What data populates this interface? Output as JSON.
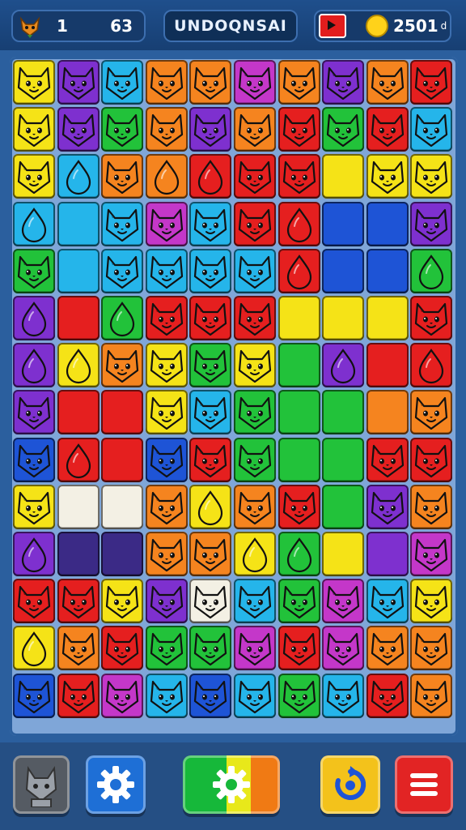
{
  "hud": {
    "level": "1",
    "moves": "63",
    "title": "UNDOQNSAI",
    "score": "2501",
    "score_unit": "d",
    "icons": {
      "level": "fox-mascot-icon",
      "flag": "red-flag-icon",
      "coin": "gold-coin-icon"
    }
  },
  "colors": {
    "R": "#e51f1f",
    "O": "#f5841f",
    "Y": "#f5e317",
    "G": "#22c23a",
    "C": "#25b5ea",
    "B": "#1e54d6",
    "P": "#7e30cf",
    "M": "#c437c9",
    "W": "#f3f0e4",
    "K": "#3b2a86"
  },
  "board": {
    "columns": 10,
    "rows": 14,
    "tiles": [
      [
        "Y:cat",
        "P:cat",
        "C:cat",
        "O:cat",
        "O:cat",
        "M:cat",
        "O:cat",
        "P:cat",
        "O:cat",
        "R:cat"
      ],
      [
        "Y:cat",
        "P:cat",
        "G:cat",
        "O:cat",
        "P:cat",
        "O:cat",
        "R:cat",
        "G:cat",
        "R:cat",
        "C:cat"
      ],
      [
        "Y:cat",
        "C:drop",
        "O:cat",
        "O:drop",
        "R:drop",
        "R:cat",
        "R:cat",
        "Y:",
        "Y:cat",
        "Y:cat"
      ],
      [
        "C:drop",
        "C:",
        "C:cat",
        "M:cat",
        "C:cat",
        "R:cat",
        "R:drop",
        "B:",
        "B:",
        "P:cat"
      ],
      [
        "G:cat",
        "C:",
        "C:cat",
        "C:cat",
        "C:cat",
        "C:cat",
        "R:drop",
        "B:",
        "B:",
        "G:drop"
      ],
      [
        "P:drop",
        "R:",
        "G:drop",
        "R:cat",
        "R:cat",
        "R:cat",
        "Y:",
        "Y:",
        "Y:",
        "R:cat"
      ],
      [
        "P:drop",
        "Y:drop",
        "O:cat",
        "Y:cat",
        "G:cat",
        "Y:cat",
        "G:",
        "P:drop",
        "R:",
        "R:drop"
      ],
      [
        "P:cat",
        "R:",
        "R:",
        "Y:cat",
        "C:cat",
        "G:cat",
        "G:",
        "G:",
        "O:",
        "O:cat"
      ],
      [
        "B:cat",
        "R:drop",
        "R:",
        "B:cat",
        "R:cat",
        "G:cat",
        "G:",
        "G:",
        "R:cat",
        "R:cat"
      ],
      [
        "Y:cat",
        "W:",
        "W:",
        "O:cat",
        "Y:drop",
        "O:cat",
        "R:cat",
        "G:",
        "P:cat",
        "O:cat"
      ],
      [
        "P:drop",
        "K:",
        "K:",
        "O:cat",
        "O:cat",
        "Y:drop",
        "G:drop",
        "Y:",
        "P:",
        "M:cat"
      ],
      [
        "R:cat",
        "R:cat",
        "Y:cat",
        "P:cat",
        "W:cat",
        "C:cat",
        "G:cat",
        "M:cat",
        "C:cat",
        "Y:cat"
      ],
      [
        "Y:drop",
        "O:cat",
        "R:cat",
        "G:cat",
        "G:cat",
        "M:cat",
        "R:cat",
        "M:cat",
        "O:cat",
        "O:cat"
      ],
      [
        "B:cat",
        "R:cat",
        "M:cat",
        "C:cat",
        "B:cat",
        "C:cat",
        "G:cat",
        "C:cat",
        "R:cat",
        "O:cat"
      ]
    ]
  },
  "controls": {
    "cat": "cat-avatar-icon",
    "settings": "gear-icon",
    "hint": "gear-icon",
    "refresh": "refresh-icon",
    "menu": "hamburger-menu-icon"
  }
}
